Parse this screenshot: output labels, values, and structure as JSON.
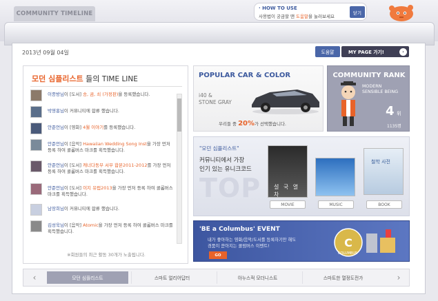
{
  "header": {
    "logo_text": "COMMUNITY TIMELINE",
    "help": {
      "title": "· HOW TO USE",
      "desc_before": "사용법이 궁금할 땐 ",
      "desc_highlight": "도움말",
      "desc_after": "을 눌러보세요",
      "close_label": "닫기"
    }
  },
  "date_bar": {
    "date": "2013년 09월 04일",
    "help_label": "도움말",
    "mypage_label": "MY PAGE 가기!",
    "mypage_arrow": "›"
  },
  "timeline": {
    "title_highlight": "모던 심플리스트",
    "title_mid": " 들의 ",
    "title_end": "TIME LINE",
    "items": [
      {
        "user": "이종방님",
        "before": "이 [도서] ",
        "highlight": "송, 곰, 쇠 (가정판)",
        "after": "을 등록했습니다."
      },
      {
        "user": "박영홍님",
        "before": "이 커뮤니티에 합류 했습니다.",
        "highlight": "",
        "after": ""
      },
      {
        "user": "안준언님",
        "before": "이 [영화] ",
        "highlight": "4월 이야기",
        "after": "를 등록했습니다."
      },
      {
        "user": "안준언님",
        "before": "이 [음악] ",
        "highlight": "Hawaiian Wedding Song Inst",
        "after": "을 가장 먼저 등록 하여 콜롬버스 마크를 획득했습니다."
      },
      {
        "user": "안준언님",
        "before": "이 [도서] ",
        "highlight": "캐너다동부 서부 합본2011-2012",
        "after": "를 가장 먼저 등록 하여 콜롬버스 마크를 획득했습니다."
      },
      {
        "user": "안준언님",
        "before": "이 [도서] ",
        "highlight": "이지 유럽2013",
        "after": "을 가장 먼저 등록 하여 콜롬버스 마크를 획득했습니다."
      },
      {
        "user": "남장희님",
        "before": "이 커뮤니티에 합류 했습니다.",
        "highlight": "",
        "after": ""
      },
      {
        "user": "김성욱님",
        "before": "이 [음악] ",
        "highlight": "Atomic",
        "after": "을 가장 먼저 등록 하여 콜롬버스 마크를 획득했습니다."
      }
    ],
    "footer": "※회원들의 최근 활동 30개가 노출됩니다."
  },
  "car": {
    "title": "POPULAR CAR & COLOR",
    "model": "i40 &",
    "color": "STONE GRAY",
    "stat_before": "우리들 중 ",
    "stat_pct": "20%",
    "stat_after": "가 선택했습니다."
  },
  "rank": {
    "title": "COMMUNITY RANK",
    "label1": "MODERN",
    "label2": "SENSIBLE BEING",
    "number": "4",
    "unit": "위",
    "count": "1135명"
  },
  "unique": {
    "tag": "\"모던 심플리스트\"",
    "line1": "커뮤니티에서 가장",
    "line2": "인기 있는 유니크코드",
    "watermark": "TOP",
    "movie_caption": "설 국 열 차",
    "book_caption": "철학 사전",
    "movie_label": "MOVIE",
    "music_label": "MUSIC",
    "book_label": "BOOK"
  },
  "event": {
    "title": "'BE a Columbus' EVENT",
    "line1": "내가 좋아하는 영화/음악/도서를 등록하기만 해도",
    "line2": "경품이 쏟아지는 콜럼버스 이벤트!",
    "go_label": "GO",
    "logo_text": "COLUMBUS"
  },
  "bottom_nav": {
    "prev": "‹",
    "next": "›",
    "tabs": [
      "모던 심플리스트",
      "스마트 얼리어답터",
      "아누스적 모더니스트",
      "스마트한 열정도전가"
    ]
  },
  "colors": {
    "accent_blue": "#3d5a9e",
    "accent_orange": "#e8632a",
    "rank_bg": "#9fa1b3",
    "event_bg": "#3d56a0"
  }
}
